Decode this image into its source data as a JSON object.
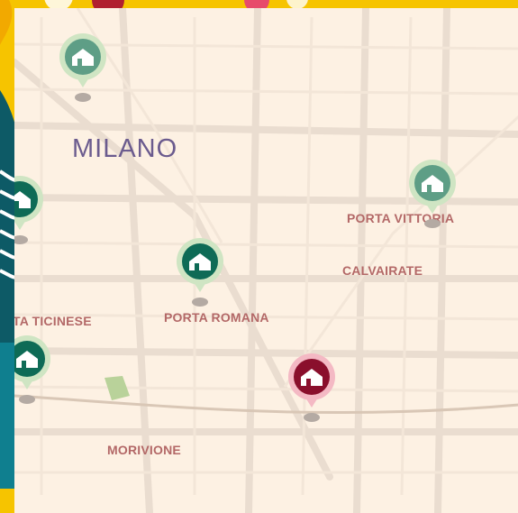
{
  "map": {
    "city_label": "MILANO",
    "districts": [
      {
        "id": "porta-vittoria",
        "label": "PORTA VITTORIA"
      },
      {
        "id": "calvairate",
        "label": "CALVAIRATE"
      },
      {
        "id": "porta-ticinese",
        "label": "TA TICINESE"
      },
      {
        "id": "porta-romana",
        "label": "PORTA ROMANA"
      },
      {
        "id": "morivione",
        "label": "MORIVIONE"
      }
    ],
    "markers": [
      {
        "id": "marker-1",
        "icon": "house-icon",
        "state": "muted",
        "color": "#5e9e86"
      },
      {
        "id": "marker-2",
        "icon": "house-icon",
        "state": "muted",
        "color": "#5e9e86"
      },
      {
        "id": "marker-3",
        "icon": "house-icon",
        "state": "active",
        "color": "#0e6b56"
      },
      {
        "id": "marker-4",
        "icon": "house-icon",
        "state": "active",
        "color": "#0e6b56"
      },
      {
        "id": "marker-5",
        "icon": "house-icon",
        "state": "active",
        "color": "#0e6b56"
      },
      {
        "id": "marker-6",
        "icon": "house-icon",
        "state": "highlight",
        "color": "#8a0f2c"
      }
    ],
    "colors": {
      "background": "#fdf1e3",
      "street": "#eaddd0",
      "label": "#b36867",
      "city": "#6b5b8e",
      "park": "#b9d29a",
      "frame_yellow": "#f6c400",
      "frame_teal": "#0d5a66"
    }
  }
}
